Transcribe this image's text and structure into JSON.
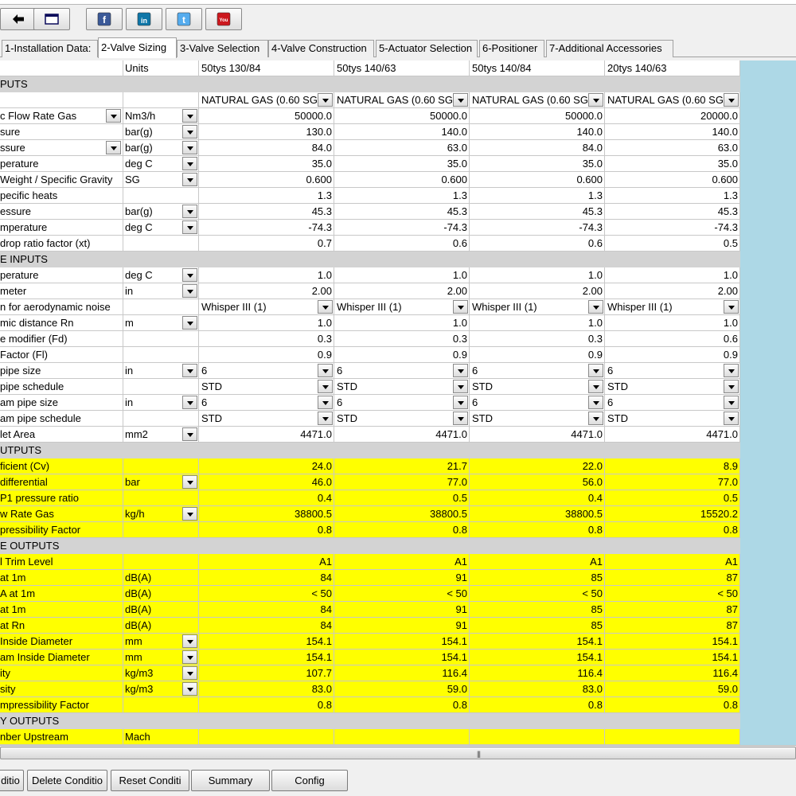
{
  "toolbar": {
    "buttons": [
      {
        "name": "back-button",
        "icon": "back-arrow-icon"
      },
      {
        "name": "window-button",
        "icon": "window-icon"
      },
      {
        "name": "facebook-button",
        "icon": "facebook-icon",
        "glyph": "f",
        "color": "#3b5998"
      },
      {
        "name": "linkedin-button",
        "icon": "linkedin-icon",
        "glyph": "in",
        "color": "#0e76a8"
      },
      {
        "name": "twitter-button",
        "icon": "twitter-icon",
        "glyph": "t",
        "color": "#55acee"
      },
      {
        "name": "youtube-button",
        "icon": "youtube-icon",
        "glyph": "You",
        "color": "#cc181e"
      }
    ]
  },
  "tabs": [
    {
      "label": "1-Installation Data:",
      "active": false
    },
    {
      "label": "2-Valve Sizing",
      "active": true
    },
    {
      "label": "3-Valve Selection",
      "active": false
    },
    {
      "label": "4-Valve Construction",
      "active": false
    },
    {
      "label": "5-Actuator Selection",
      "active": false
    },
    {
      "label": "6-Positioner",
      "active": false
    },
    {
      "label": "7-Additional Accessories",
      "active": false
    }
  ],
  "grid": {
    "header": {
      "units": "Units",
      "cols": [
        "50tys 130/84",
        "50tys 140/63",
        "50tys 140/84",
        "20tys 140/63"
      ]
    },
    "rows": [
      {
        "type": "section",
        "label": "PUTS"
      },
      {
        "type": "normal",
        "label": "",
        "units": "",
        "vals": [
          "NATURAL GAS (0.60 SG",
          "NATURAL GAS (0.60 SG",
          "NATURAL GAS (0.60 SG",
          "NATURAL GAS (0.60 SG"
        ],
        "valdd": true,
        "valtext": true
      },
      {
        "type": "normal",
        "label": "c Flow Rate Gas",
        "labeldd": true,
        "units": "Nm3/h",
        "unitsdd": true,
        "vals": [
          "50000.0",
          "50000.0",
          "50000.0",
          "20000.0"
        ]
      },
      {
        "type": "normal",
        "label": "sure",
        "units": "bar(g)",
        "unitsdd": true,
        "vals": [
          "130.0",
          "140.0",
          "140.0",
          "140.0"
        ]
      },
      {
        "type": "normal",
        "label": "ssure",
        "labeldd": true,
        "units": "bar(g)",
        "unitsdd": true,
        "vals": [
          "84.0",
          "63.0",
          "84.0",
          "63.0"
        ]
      },
      {
        "type": "normal",
        "label": "perature",
        "units": "deg C",
        "unitsdd": true,
        "vals": [
          "35.0",
          "35.0",
          "35.0",
          "35.0"
        ]
      },
      {
        "type": "normal",
        "label": "Weight / Specific Gravity",
        "units": "SG",
        "unitsdd": true,
        "vals": [
          "0.600",
          "0.600",
          "0.600",
          "0.600"
        ]
      },
      {
        "type": "normal",
        "label": "pecific heats",
        "units": "",
        "vals": [
          "1.3",
          "1.3",
          "1.3",
          "1.3"
        ]
      },
      {
        "type": "normal",
        "label": "essure",
        "units": "bar(g)",
        "unitsdd": true,
        "vals": [
          "45.3",
          "45.3",
          "45.3",
          "45.3"
        ]
      },
      {
        "type": "normal",
        "label": "mperature",
        "units": "deg C",
        "unitsdd": true,
        "vals": [
          "-74.3",
          "-74.3",
          "-74.3",
          "-74.3"
        ]
      },
      {
        "type": "normal",
        "label": "drop ratio factor (xt)",
        "units": "",
        "vals": [
          "0.7",
          "0.6",
          "0.6",
          "0.5"
        ]
      },
      {
        "type": "section",
        "label": "E INPUTS"
      },
      {
        "type": "normal",
        "label": "perature",
        "units": "deg C",
        "unitsdd": true,
        "vals": [
          "1.0",
          "1.0",
          "1.0",
          "1.0"
        ]
      },
      {
        "type": "normal",
        "label": "meter",
        "units": "in",
        "unitsdd": true,
        "vals": [
          "2.00",
          "2.00",
          "2.00",
          "2.00"
        ]
      },
      {
        "type": "normal",
        "label": "n for aerodynamic noise",
        "units": "",
        "vals": [
          "Whisper III (1)",
          "Whisper III (1)",
          "Whisper III (1)",
          "Whisper III (1)"
        ],
        "valdd": true,
        "valtext": true
      },
      {
        "type": "normal",
        "label": "mic distance Rn",
        "units": "m",
        "unitsdd": true,
        "vals": [
          "1.0",
          "1.0",
          "1.0",
          "1.0"
        ]
      },
      {
        "type": "normal",
        "label": "e modifier (Fd)",
        "units": "",
        "vals": [
          "0.3",
          "0.3",
          "0.3",
          "0.6"
        ]
      },
      {
        "type": "normal",
        "label": "Factor (Fl)",
        "units": "",
        "vals": [
          "0.9",
          "0.9",
          "0.9",
          "0.9"
        ]
      },
      {
        "type": "normal",
        "label": "pipe size",
        "units": "in",
        "unitsdd": true,
        "vals": [
          "6",
          "6",
          "6",
          "6"
        ],
        "valdd": true,
        "valtext": true
      },
      {
        "type": "normal",
        "label": "pipe schedule",
        "units": "",
        "vals": [
          "STD",
          "STD",
          "STD",
          "STD"
        ],
        "valdd": true,
        "valtext": true
      },
      {
        "type": "normal",
        "label": "am pipe size",
        "units": "in",
        "unitsdd": true,
        "vals": [
          "6",
          "6",
          "6",
          "6"
        ],
        "valdd": true,
        "valtext": true
      },
      {
        "type": "normal",
        "label": "am pipe schedule",
        "units": "",
        "vals": [
          "STD",
          "STD",
          "STD",
          "STD"
        ],
        "valdd": true,
        "valtext": true
      },
      {
        "type": "normal",
        "label": "let Area",
        "units": "mm2",
        "unitsdd": true,
        "vals": [
          "4471.0",
          "4471.0",
          "4471.0",
          "4471.0"
        ]
      },
      {
        "type": "section",
        "label": "UTPUTS"
      },
      {
        "type": "yellow",
        "label": "ficient (Cv)",
        "units": "",
        "vals": [
          "24.0",
          "21.7",
          "22.0",
          "8.9"
        ]
      },
      {
        "type": "yellow",
        "label": "differential",
        "units": "bar",
        "unitsdd": true,
        "vals": [
          "46.0",
          "77.0",
          "56.0",
          "77.0"
        ]
      },
      {
        "type": "yellow",
        "label": "P1 pressure ratio",
        "units": "",
        "vals": [
          "0.4",
          "0.5",
          "0.4",
          "0.5"
        ]
      },
      {
        "type": "yellow",
        "label": "w Rate Gas",
        "units": "kg/h",
        "unitsdd": true,
        "vals": [
          "38800.5",
          "38800.5",
          "38800.5",
          "15520.2"
        ]
      },
      {
        "type": "yellow",
        "label": "pressibility Factor",
        "units": "",
        "vals": [
          "0.8",
          "0.8",
          "0.8",
          "0.8"
        ]
      },
      {
        "type": "section",
        "label": "E OUTPUTS"
      },
      {
        "type": "yellow",
        "label": "l Trim Level",
        "units": "",
        "vals": [
          "A1",
          "A1",
          "A1",
          "A1"
        ]
      },
      {
        "type": "yellow",
        "label": "at 1m",
        "units": "dB(A)",
        "vals": [
          "84",
          "91",
          "85",
          "87"
        ]
      },
      {
        "type": "yellow",
        "label": "A at 1m",
        "units": "dB(A)",
        "vals": [
          "< 50",
          "< 50",
          "< 50",
          "< 50"
        ]
      },
      {
        "type": "yellow",
        "label": "at 1m",
        "units": "dB(A)",
        "vals": [
          "84",
          "91",
          "85",
          "87"
        ]
      },
      {
        "type": "yellow",
        "label": "at Rn",
        "units": "dB(A)",
        "vals": [
          "84",
          "91",
          "85",
          "87"
        ]
      },
      {
        "type": "yellow",
        "label": "Inside Diameter",
        "units": "mm",
        "unitsdd": true,
        "vals": [
          "154.1",
          "154.1",
          "154.1",
          "154.1"
        ]
      },
      {
        "type": "yellow",
        "label": "am Inside Diameter",
        "units": "mm",
        "unitsdd": true,
        "vals": [
          "154.1",
          "154.1",
          "154.1",
          "154.1"
        ]
      },
      {
        "type": "yellow",
        "label": "ity",
        "units": "kg/m3",
        "unitsdd": true,
        "vals": [
          "107.7",
          "116.4",
          "116.4",
          "116.4"
        ]
      },
      {
        "type": "yellow",
        "label": "sity",
        "units": "kg/m3",
        "unitsdd": true,
        "vals": [
          "83.0",
          "59.0",
          "83.0",
          "59.0"
        ]
      },
      {
        "type": "yellow",
        "label": "mpressibility Factor",
        "units": "",
        "vals": [
          "0.8",
          "0.8",
          "0.8",
          "0.8"
        ]
      },
      {
        "type": "section",
        "label": "Y OUTPUTS"
      },
      {
        "type": "yellow",
        "label": "nber Upstream",
        "units": "Mach",
        "vals": [
          "",
          "",
          "",
          ""
        ]
      }
    ]
  },
  "scrollbar": {
    "grip": "|||"
  },
  "bottom_buttons": [
    {
      "label": "ditio"
    },
    {
      "label": "Delete Conditio"
    },
    {
      "label": "Reset Conditi"
    },
    {
      "label": "Summary"
    },
    {
      "label": "Config"
    }
  ]
}
